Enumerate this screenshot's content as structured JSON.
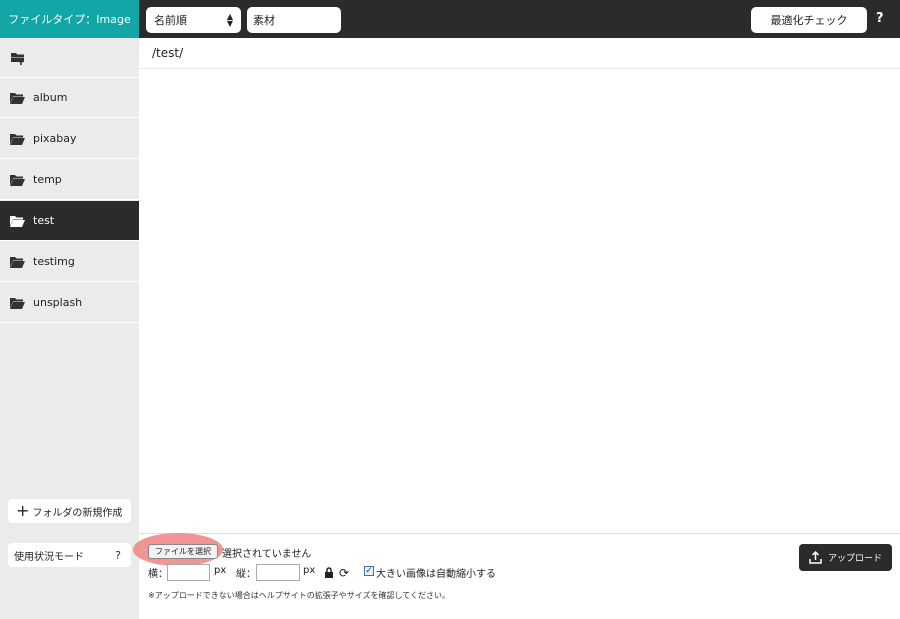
{
  "topbar": {
    "filetype_label": "ファイルタイプ：Image",
    "sort": {
      "selected": "名前順"
    },
    "search": {
      "value": "素材"
    },
    "optimize_label": "最適化チェック",
    "help_label": "?"
  },
  "path": "/test/",
  "sidebar": {
    "folders": [
      {
        "label": "album"
      },
      {
        "label": "pixabay"
      },
      {
        "label": "temp"
      },
      {
        "label": "test"
      },
      {
        "label": "testimg"
      },
      {
        "label": "unsplash"
      }
    ],
    "active_folder": "test",
    "new_folder_label": "フォルダの新規作成",
    "usage_mode_label": "使用状況モード",
    "usage_help_label": "?"
  },
  "upload": {
    "file_button_label": "ファイルを選択",
    "no_file_text": "選択されていません",
    "width_label": "横：",
    "height_label": "縦：",
    "px_label": "px",
    "auto_shrink_label": "大きい画像は自動縮小する",
    "auto_shrink_checked": true,
    "note": "※アップロードできない場合はヘルプサイトの拡張子やサイズを確認してください。",
    "upload_button_label": "アップロード"
  },
  "colors": {
    "accent": "#12a6a6",
    "dark": "#2b2b2b",
    "highlight": "#ee8888"
  }
}
